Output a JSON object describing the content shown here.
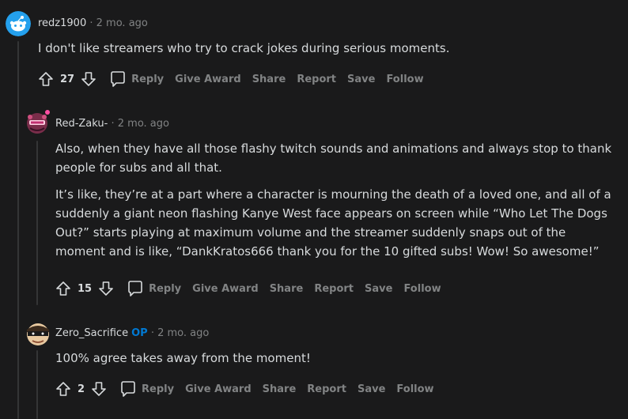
{
  "comments": [
    {
      "username": "redz1900",
      "op": "",
      "dot": "·",
      "time": "2 mo. ago",
      "paragraphs": [
        "I don't like streamers who try to crack jokes during serious moments."
      ],
      "votes": "27"
    },
    {
      "username": "Red-Zaku-",
      "op": "",
      "dot": "·",
      "time": "2 mo. ago",
      "paragraphs": [
        "Also, when they have all those flashy twitch sounds and animations and always stop to thank people for subs and all that.",
        "It’s like, they’re at a part where a character is mourning the death of a loved one, and all of a suddenly a giant neon flashing Kanye West face appears on screen while “Who Let The Dogs Out?” starts playing at maximum volume and the streamer suddenly snaps out of the moment and is like, “DankKratos666 thank you for the 10 gifted subs! Wow! So awesome!”"
      ],
      "votes": "15"
    },
    {
      "username": "Zero_Sacrifice",
      "op": "OP",
      "dot": "·",
      "time": "2 mo. ago",
      "paragraphs": [
        "100% agree takes away from the moment!"
      ],
      "votes": "2"
    }
  ],
  "actions": {
    "reply": "Reply",
    "give_award": "Give Award",
    "share": "Share",
    "report": "Report",
    "save": "Save",
    "follow": "Follow"
  },
  "icons": {
    "upvote": "upvote-arrow-icon",
    "downvote": "downvote-arrow-icon",
    "reply": "speech-bubble-icon"
  },
  "colors": {
    "background": "#1a1a1b",
    "text": "#d7dadc",
    "meta": "#818384",
    "op": "#0079d3",
    "thread_line": "#343536"
  }
}
